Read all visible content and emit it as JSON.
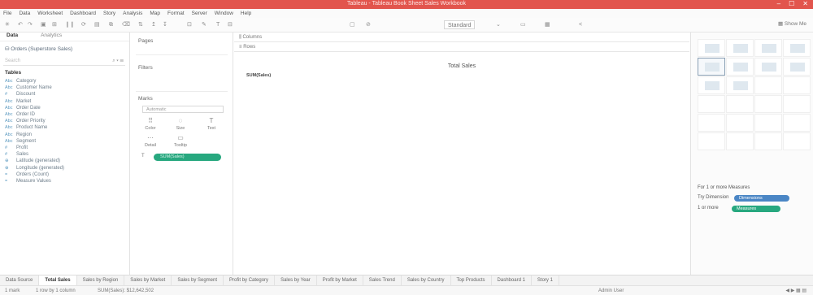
{
  "window": {
    "title": "Tableau - Tableau Book Sheet Sales Workbook"
  },
  "menu": [
    "File",
    "Data",
    "Worksheet",
    "Dashboard",
    "Story",
    "Analysis",
    "Map",
    "Format",
    "Server",
    "Window",
    "Help"
  ],
  "toolbar": {
    "fit_value": "Standard",
    "show_me_label": "Show Me"
  },
  "data_pane": {
    "tabs": [
      "Data",
      "Analytics"
    ],
    "data_source": "Orders (Superstore Sales)",
    "search_placeholder": "Search",
    "tables_heading": "Tables",
    "fields": [
      {
        "type": "Abc",
        "name": "Category"
      },
      {
        "type": "Abc",
        "name": "Customer Name"
      },
      {
        "type": "#",
        "name": "Discount"
      },
      {
        "type": "Abc",
        "name": "Market"
      },
      {
        "type": "Abc",
        "name": "Order Date"
      },
      {
        "type": "Abc",
        "name": "Order ID"
      },
      {
        "type": "Abc",
        "name": "Order Priority"
      },
      {
        "type": "Abc",
        "name": "Product Name"
      },
      {
        "type": "Abc",
        "name": "Region"
      },
      {
        "type": "Abc",
        "name": "Segment"
      },
      {
        "type": "#",
        "name": "Profit"
      },
      {
        "type": "#",
        "name": "Sales"
      },
      {
        "type": "⊕",
        "name": "Latitude (generated)"
      },
      {
        "type": "⊕",
        "name": "Longitude (generated)"
      },
      {
        "type": "=",
        "name": "Orders (Count)"
      },
      {
        "type": "=",
        "name": "Measure Values"
      }
    ]
  },
  "cards": {
    "pages": "Pages",
    "filters": "Filters",
    "marks": "Marks",
    "marks_type": "Automatic",
    "mark_buttons": [
      {
        "icon": "⠿",
        "label": "Color"
      },
      {
        "icon": "◌",
        "label": "Size"
      },
      {
        "icon": "T",
        "label": "Text"
      },
      {
        "icon": "⋯",
        "label": "Detail"
      },
      {
        "icon": "▭",
        "label": "Tooltip"
      }
    ],
    "measure_pill": "SUM(Sales)"
  },
  "shelves": {
    "columns": "Columns",
    "rows": "Rows"
  },
  "view": {
    "sheet_title": "Total Sales",
    "field_label": "SUM(Sales)"
  },
  "show_me": {
    "for_text": "For 1 or more Measures",
    "row2_label": "Try Dimension",
    "row2_pill": "Dimensions",
    "row3_label": "1 or more",
    "row3_pill": "Measures",
    "pill_colors": {
      "dimension": "#4a86c5",
      "measure": "#27a87f"
    }
  },
  "sheet_tabs": [
    "Data Source",
    "Total Sales",
    "Sales by Region",
    "Sales by Market",
    "Sales by Segment",
    "Profit by Category",
    "Sales by Year",
    "Profit by Market",
    "Sales Trend",
    "Sales by Country",
    "Top Products",
    "Dashboard 1",
    "Story 1"
  ],
  "active_tab": 1,
  "status": {
    "marks": "1 mark",
    "rows_cols": "1 row by 1 column",
    "sum": "SUM(Sales): $12,642,502",
    "user": "Admin User"
  }
}
